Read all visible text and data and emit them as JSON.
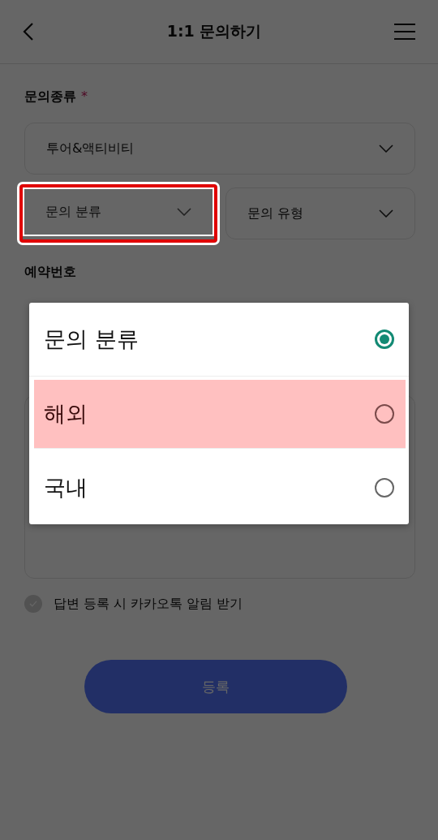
{
  "header": {
    "title": "1:1 문의하기"
  },
  "form": {
    "category": {
      "label": "문의종류",
      "required_mark": "*",
      "value": "투어&액티비티"
    },
    "selects": [
      {
        "placeholder": "문의 분류",
        "highlighted": true
      },
      {
        "placeholder": "문의 유형",
        "highlighted": false
      }
    ],
    "reservation": {
      "label": "예약번호"
    },
    "kakao_notice": {
      "label": "답변 등록 시 카카오톡 알림 받기",
      "checked": false
    },
    "submit": "등록"
  },
  "dialog": {
    "options": [
      {
        "label": "문의 분류",
        "selected": true,
        "highlighted": false
      },
      {
        "label": "해외",
        "selected": false,
        "highlighted": true
      },
      {
        "label": "국내",
        "selected": false,
        "highlighted": false
      }
    ]
  }
}
